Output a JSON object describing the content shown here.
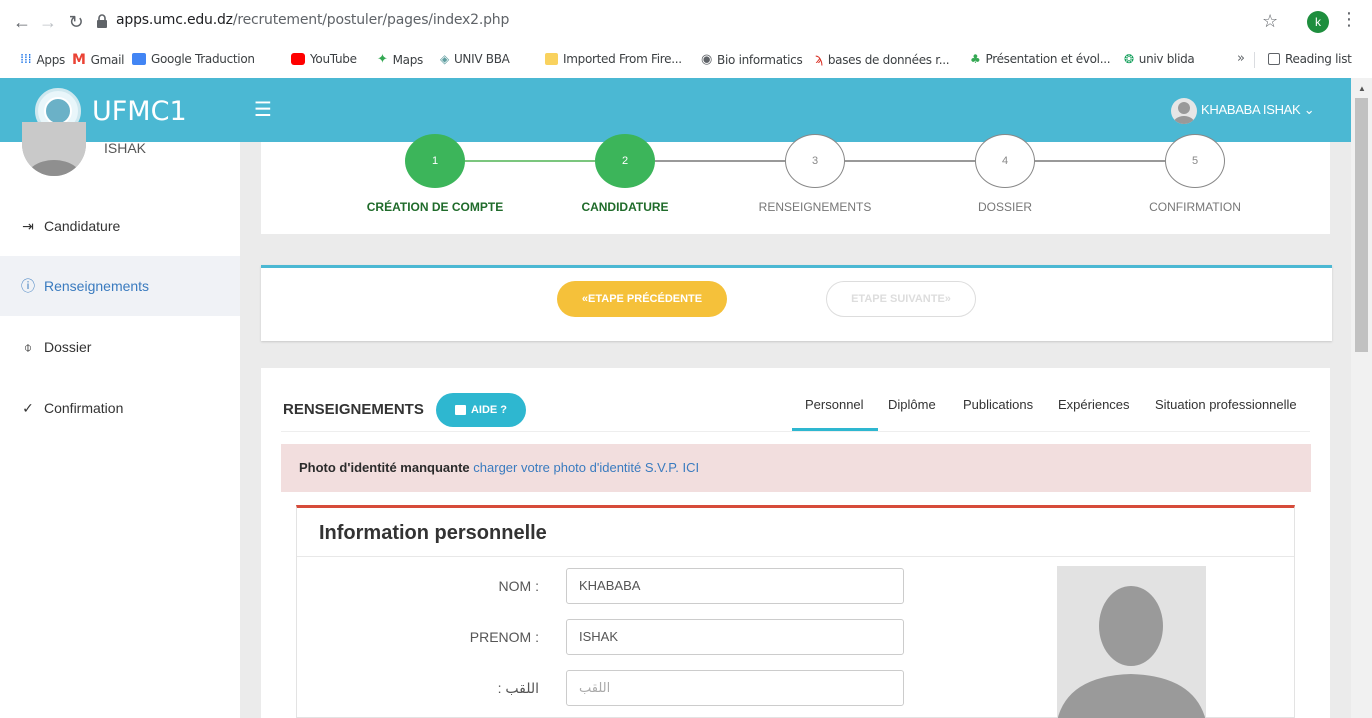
{
  "browser": {
    "url_host": "apps.umc.edu.dz",
    "url_path": "/recrutement/postuler/pages/index2.php",
    "profile_initial": "k",
    "more_label": "»",
    "reading_list": "Reading list",
    "bookmarks": [
      {
        "label": "Apps",
        "color": "#1a73e8"
      },
      {
        "label": "Gmail",
        "color": "#ea4335"
      },
      {
        "label": "Google Traduction",
        "color": "#4285f4"
      },
      {
        "label": "YouTube",
        "color": "#ff0000"
      },
      {
        "label": "Maps",
        "color": "#34a853"
      },
      {
        "label": "UNIV BBA",
        "color": "#5f9ea0"
      },
      {
        "label": "Imported From Fire...",
        "color": "#f9d25e"
      },
      {
        "label": "Bio informatics",
        "color": "#5f6368"
      },
      {
        "label": "bases de données r...",
        "color": "#d93025"
      },
      {
        "label": "Présentation et évol...",
        "color": "#34a853"
      },
      {
        "label": "univ blida",
        "color": "#0f9d58"
      }
    ]
  },
  "header": {
    "app_title": "UFMC1",
    "user_name": "KHABABA ISHAK",
    "user_caret": "⌄",
    "accent": "#4bb8d3"
  },
  "sidebar": {
    "user_short": "ISHAK",
    "items": [
      {
        "label": "Candidature",
        "icon": "login-icon"
      },
      {
        "label": "Renseignements",
        "icon": "info-icon"
      },
      {
        "label": "Dossier",
        "icon": "paperclip-icon"
      },
      {
        "label": "Confirmation",
        "icon": "check-icon"
      }
    ]
  },
  "stepper": {
    "steps": [
      {
        "num": "1",
        "label": "CRÉATION DE COMPTE",
        "done": true
      },
      {
        "num": "2",
        "label": "CANDIDATURE",
        "done": true
      },
      {
        "num": "3",
        "label": "RENSEIGNEMENTS",
        "done": false
      },
      {
        "num": "4",
        "label": "DOSSIER",
        "done": false
      },
      {
        "num": "5",
        "label": "CONFIRMATION",
        "done": false
      }
    ]
  },
  "navigation": {
    "prev_label": "ETAPE PRÉCÉDENTE",
    "prev_icon": "«",
    "next_label": "ETAPE SUIVANTE",
    "next_icon": "»"
  },
  "section": {
    "title": "RENSEIGNEMENTS",
    "aide_label": "AIDE ?",
    "tabs": [
      "Personnel",
      "Diplôme",
      "Publications",
      "Expériences",
      "Situation professionnelle"
    ],
    "active_tab": "Personnel"
  },
  "alert": {
    "bold_text": "Photo d'identité manquante",
    "link_text": "charger votre photo d'identité S.V.P. ICI",
    "color": "#f2dede"
  },
  "form": {
    "title": "Information personnelle",
    "fields": [
      {
        "label": "NOM :",
        "value": "KHABABA",
        "placeholder": ""
      },
      {
        "label": "PRENOM :",
        "value": "ISHAK",
        "placeholder": ""
      },
      {
        "label": ": اللقب",
        "value": "",
        "placeholder": "اللقب"
      }
    ]
  }
}
